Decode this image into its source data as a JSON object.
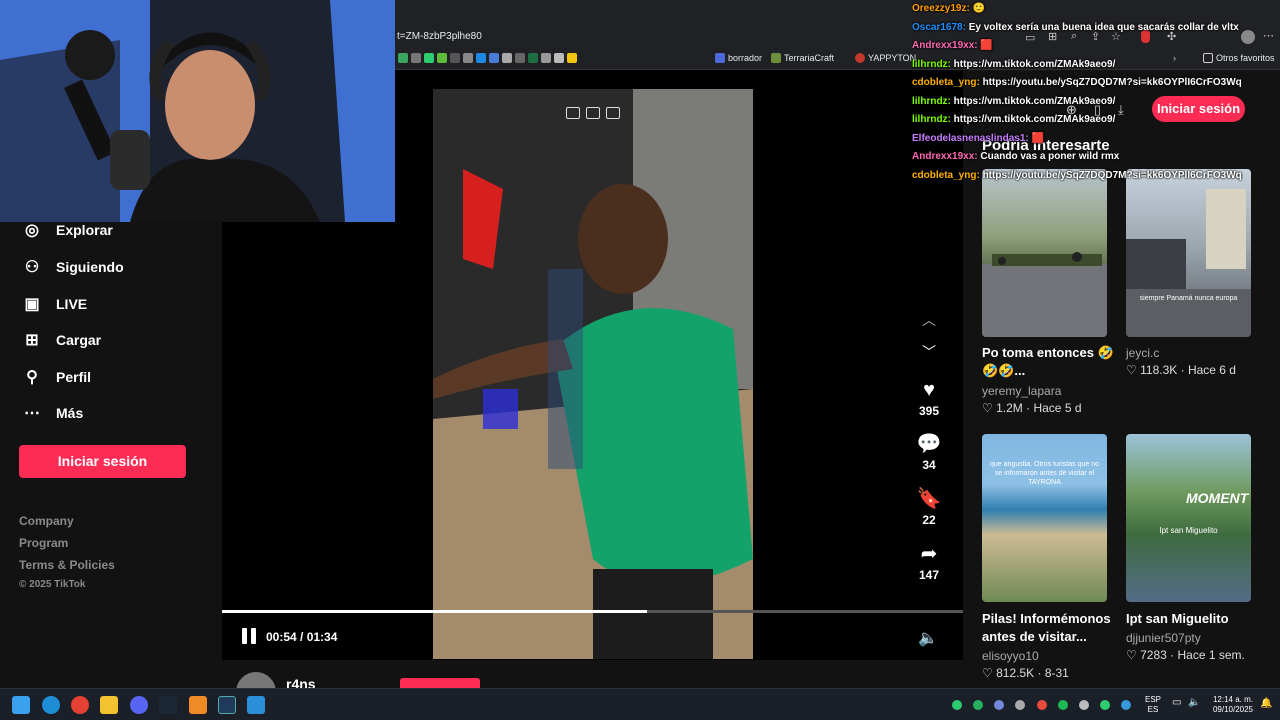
{
  "browser": {
    "url": "t=ZM-8zbP3plhe80",
    "bookmarks": [
      {
        "label": "borrador",
        "color": "#4f6ad8"
      },
      {
        "label": "TerrariaCraft",
        "color": "#6b8f3a"
      },
      {
        "label": "YAPPYTON",
        "color": "#c0392b"
      }
    ],
    "other_bookmarks": "Otros favoritos"
  },
  "sidebar": {
    "items": [
      {
        "label": "Explorar",
        "icon": "compass-icon"
      },
      {
        "label": "Siguiendo",
        "icon": "person-follow-icon"
      },
      {
        "label": "LIVE",
        "icon": "live-tv-icon"
      },
      {
        "label": "Cargar",
        "icon": "upload-plus-icon"
      },
      {
        "label": "Perfil",
        "icon": "person-icon"
      },
      {
        "label": "Más",
        "icon": "more-dots-icon"
      }
    ],
    "login_label": "Iniciar sesión",
    "footer": [
      "Company",
      "Program",
      "Terms & Policies"
    ],
    "copyright": "© 2025 TikTok"
  },
  "player": {
    "current_time": "00:54",
    "duration": "01:34",
    "time_text": "00:54 / 01:34",
    "progress_fraction": 0.574,
    "author": "r4ns"
  },
  "actions": {
    "likes": "395",
    "comments": "34",
    "saves": "22",
    "shares": "147"
  },
  "header": {
    "login_label": "Iniciar sesión"
  },
  "recommendations": {
    "title": "Podría interesarte",
    "cards": [
      {
        "title": "Po toma entonces 🤣🤣🤣...",
        "user": "yeremy_lapara",
        "likes": "1.2M",
        "age": "Hace 5 d",
        "overlay": ""
      },
      {
        "title": "",
        "user": "jeyci.c",
        "likes": "118.3K",
        "age": "Hace 6 d",
        "overlay": "siempre Panamá nunca europa"
      },
      {
        "title": "Pilas! Informémonos antes de visitar...",
        "user": "elisoyyo10",
        "likes": "812.5K",
        "age": "8-31",
        "overlay": "que angustia. Otros turistas que no se informaron antes de visitar el TAYRONA"
      },
      {
        "title": "Ipt san Miguelito",
        "user": "djjunier507pty",
        "likes": "7283",
        "age": "Hace 1 sem.",
        "overlay": "Ipt san Miguelito"
      }
    ],
    "moment_text": "MOMENT"
  },
  "chat": [
    {
      "user": "Oreezzy19z:",
      "color": "#ff9d00",
      "message": "🙂"
    },
    {
      "user": "Oscar1678:",
      "color": "#1e90ff",
      "message": "Ey voltex sería una buena idea que sacarás collar de vltx"
    },
    {
      "user": "Andrexx19xx:",
      "color": "#ff69b4",
      "message": "🟥"
    },
    {
      "user": "lilhrndz:",
      "color": "#7cfc00",
      "message": "https://vm.tiktok.com/ZMAk9aeo9/"
    },
    {
      "user": "cdobleta_yng:",
      "color": "#ffb000",
      "message": "https://youtu.be/ySqZ7DQD7M?si=kk6OYPlI6CrFO3Wq"
    },
    {
      "user": "lilhrndz:",
      "color": "#7cfc00",
      "message": "https://vm.tiktok.com/ZMAk9aeo9/"
    },
    {
      "user": "lilhrndz:",
      "color": "#7cfc00",
      "message": "https://vm.tiktok.com/ZMAk9aeo9/"
    },
    {
      "user": "Elfeodelasnenaslindas1:",
      "color": "#c77dff",
      "message": "🟥"
    },
    {
      "user": "Andrexx19xx:",
      "color": "#ff69b4",
      "message": "Cuando vas a poner wild rmx"
    },
    {
      "user": "cdobleta_yng:",
      "color": "#ffb000",
      "message": "https://youtu.be/ySqZ7DQD7M?si=kk6OYPlI6CrFO3Wq"
    }
  ],
  "taskbar": {
    "lang_top": "ESP",
    "lang_bottom": "ES",
    "time": "12:14 a. m.",
    "date": "09/10/2025"
  },
  "colors": {
    "accent": "#fe2c55",
    "background": "#121212"
  }
}
